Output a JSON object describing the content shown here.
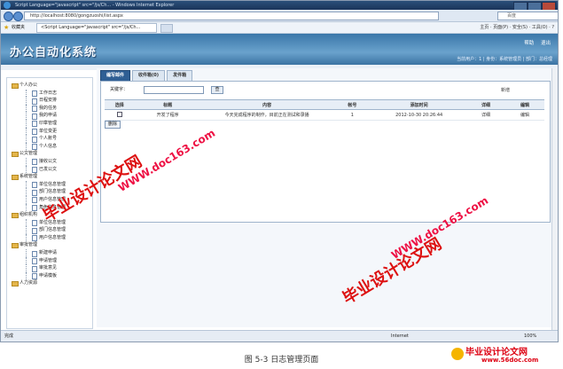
{
  "browser": {
    "title": "Script Language=\"javascript\" src=\"/js/Ch... - Windows Internet Explorer",
    "url": "http://localhost:8080/gongzuoshi/list.aspx",
    "search_placeholder": "百度",
    "favorites_label": "收藏夹",
    "tab_label": "<Script Language=\"javascript\" src=\"/js/Ch...",
    "tools": [
      "主页",
      "页面(P)",
      "安全(S)",
      "工具(O)",
      "?"
    ],
    "status_done": "完成",
    "status_zone": "Internet",
    "status_zoom": "100%"
  },
  "app": {
    "title": "办公自动化系统",
    "help_label": "帮助",
    "logout_label": "退出",
    "user_info": "当前用户：1 | 身份：系统管理员 | 部门：总经理"
  },
  "sidebar": {
    "groups": [
      {
        "label": "个人办公",
        "items": [
          "工作日志",
          "日程安排",
          "我的任务",
          "我的申请",
          "印章管理",
          "单位变更",
          "个人账号",
          "个人信息"
        ]
      },
      {
        "label": "公文管理",
        "items": [
          "接收公文",
          "已发公文"
        ]
      },
      {
        "label": "系统管理",
        "items": [
          "单位信息管理",
          "部门信息管理",
          "用户信息管理",
          "角色信息管理"
        ]
      },
      {
        "label": "组织机构",
        "items": [
          "单位信息管理",
          "部门信息管理",
          "用户信息管理"
        ]
      },
      {
        "label": "审批管理",
        "items": [
          "新建申请",
          "申请管理",
          "审批意见",
          "申请模板"
        ]
      },
      {
        "label": "人力资源",
        "items": []
      }
    ]
  },
  "main": {
    "tabs": [
      {
        "label": "编写邮件",
        "active": true
      },
      {
        "label": "收件箱(0)",
        "active": false
      },
      {
        "label": "发件箱",
        "active": false
      }
    ],
    "keyword_label": "关键字：",
    "find_label": "查",
    "add_label": "新增",
    "delete_label": "删除",
    "columns": [
      "选择",
      "标题",
      "内容",
      "帐号",
      "添加时间",
      "详细",
      "编辑"
    ],
    "rows": [
      {
        "title": "开发了程序",
        "content": "今天完成程序的制作，目前正在测试和录播",
        "account": "1",
        "time": "2012-10-30 20:26:44",
        "detail": "详细",
        "edit": "编辑"
      }
    ]
  },
  "watermarks": {
    "cn": "毕业设计论文网",
    "url": "WWW.doc163.com",
    "corner_cn": "毕业设计论文网",
    "corner_url": "www.56doc.com"
  },
  "caption": "图 5-3  日志管理页面"
}
